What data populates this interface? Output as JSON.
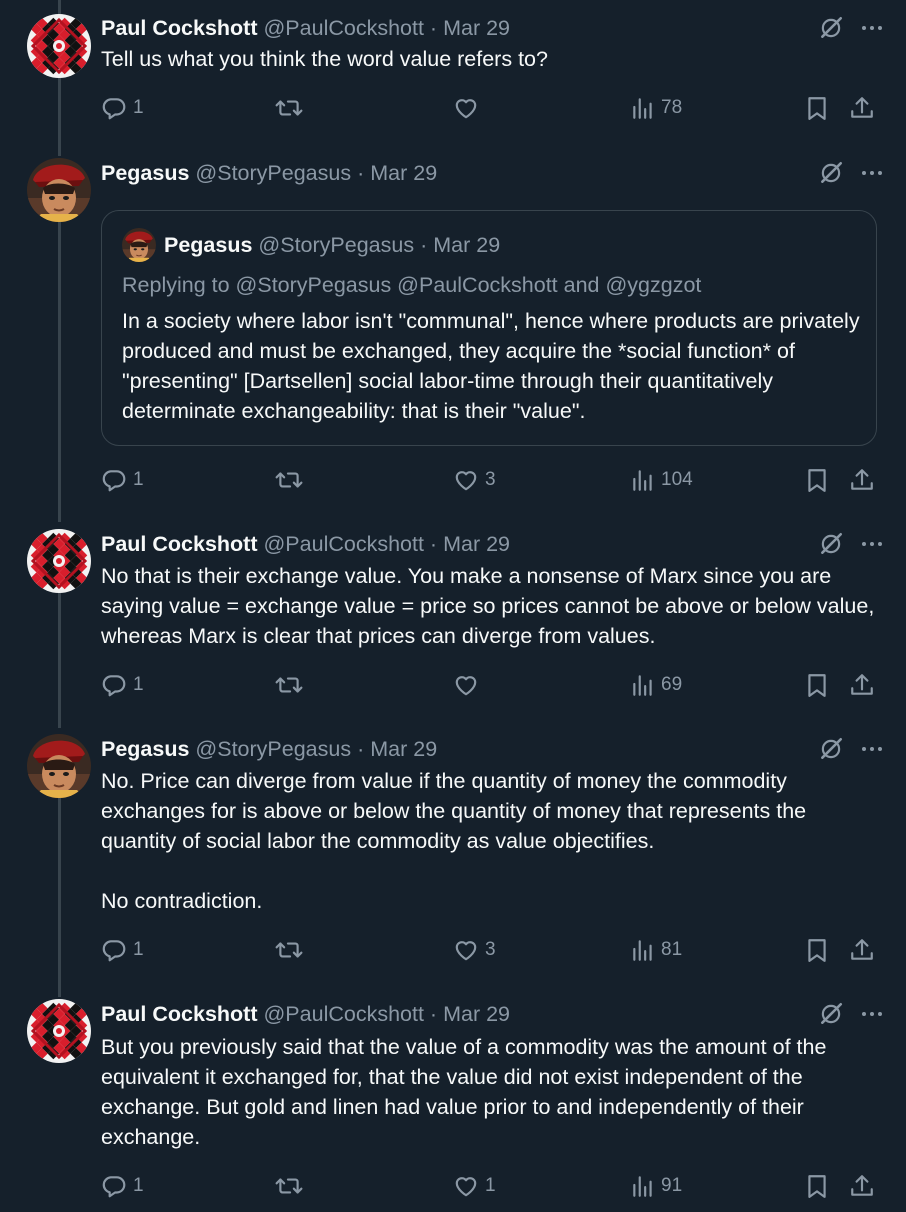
{
  "tweets": [
    {
      "name": "Paul Cockshott",
      "handle": "@PaulCockshott",
      "separator": "·",
      "date": "Mar 29",
      "text": "Tell us what you think the word value refers to?",
      "replies": "1",
      "retweets": "",
      "likes": "",
      "views": "78",
      "avatar": "paul"
    },
    {
      "name": "Pegasus",
      "handle": "@StoryPegasus",
      "separator": "·",
      "date": "Mar 29",
      "text": "",
      "quote": {
        "name": "Pegasus",
        "handle": "@StoryPegasus",
        "separator": "·",
        "date": "Mar 29",
        "replying": "Replying to @StoryPegasus @PaulCockshott and @ygzgzot",
        "text": "In a society where labor isn't \"communal\", hence where products are privately produced and must be exchanged, they acquire the *social function* of \"presenting\" [Dartsellen] social labor-time through their quantitatively determinate exchangeability: that is their \"value\"."
      },
      "replies": "1",
      "retweets": "",
      "likes": "3",
      "views": "104",
      "avatar": "pegasus"
    },
    {
      "name": "Paul Cockshott",
      "handle": "@PaulCockshott",
      "separator": "·",
      "date": "Mar 29",
      "text": "No that is their exchange value. You make a nonsense of Marx since you are saying value = exchange value = price so prices cannot be above or below value, whereas Marx is clear that prices can diverge from values.",
      "replies": "1",
      "retweets": "",
      "likes": "",
      "views": "69",
      "avatar": "paul"
    },
    {
      "name": "Pegasus",
      "handle": "@StoryPegasus",
      "separator": "·",
      "date": "Mar 29",
      "text": "No. Price can diverge from value if the quantity of money the commodity exchanges for is above or below the quantity of money that represents the quantity of social labor the commodity as value objectifies.\n\nNo contradiction.",
      "replies": "1",
      "retweets": "",
      "likes": "3",
      "views": "81",
      "avatar": "pegasus"
    },
    {
      "name": "Paul Cockshott",
      "handle": "@PaulCockshott",
      "separator": "·",
      "date": "Mar 29",
      "text": "But you previously said that the value of a commodity was the amount of the equivalent it exchanged for, that the value did not exist independent of the exchange. But gold and linen had value prior to and independently of their exchange.",
      "replies": "1",
      "retweets": "",
      "likes": "1",
      "views": "91",
      "avatar": "paul"
    }
  ],
  "colors": {
    "background": "#15202b",
    "text": "#f7f9f9",
    "muted": "#8b98a5",
    "border": "#38444d"
  },
  "icons": [
    "grok-icon",
    "more-icon",
    "reply-icon",
    "retweet-icon",
    "like-icon",
    "views-icon",
    "bookmark-icon",
    "share-icon"
  ]
}
